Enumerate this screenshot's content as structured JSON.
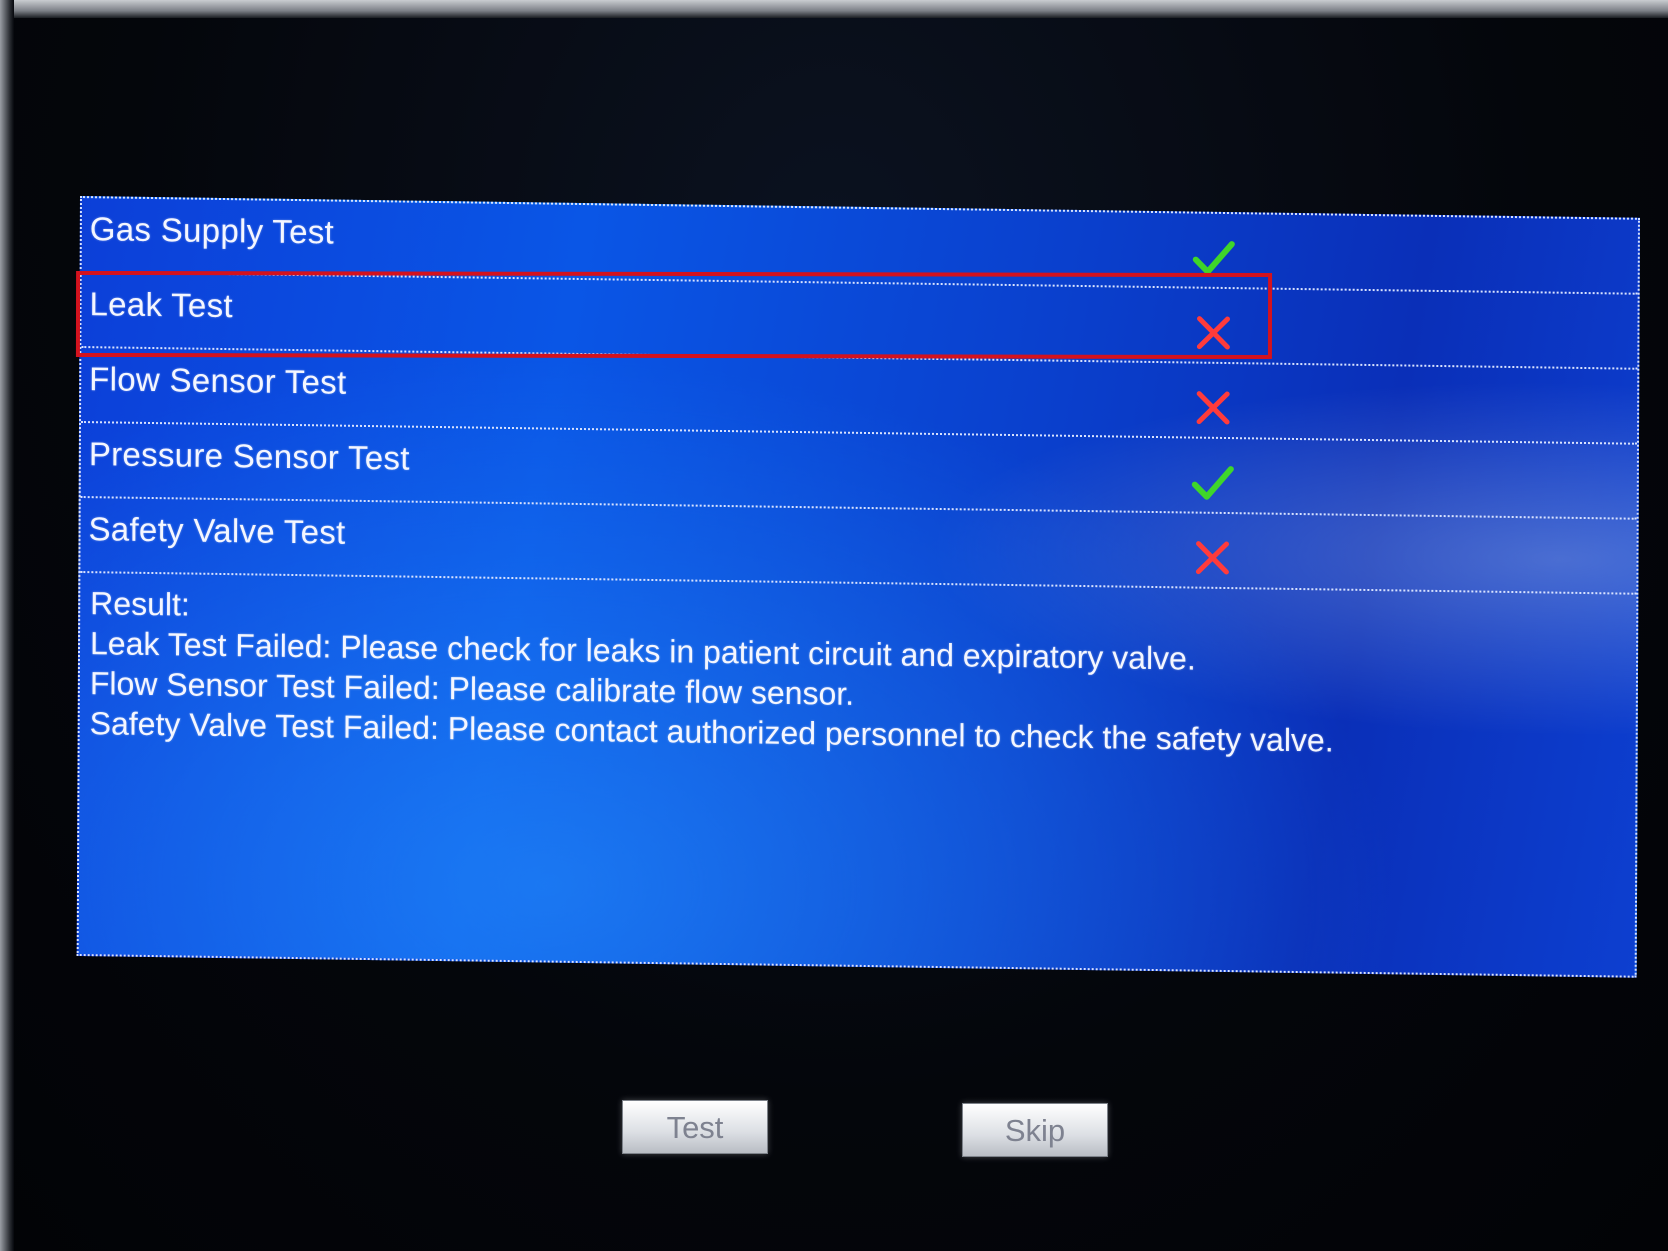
{
  "tests": [
    {
      "label": "Gas Supply Test",
      "status": "pass",
      "icon": "check-icon"
    },
    {
      "label": "Leak Test",
      "status": "fail",
      "icon": "cross-icon"
    },
    {
      "label": "Flow Sensor Test",
      "status": "fail",
      "icon": "cross-icon"
    },
    {
      "label": "Pressure Sensor Test",
      "status": "pass",
      "icon": "check-icon"
    },
    {
      "label": "Safety Valve Test",
      "status": "fail",
      "icon": "cross-icon"
    }
  ],
  "result": {
    "heading": "Result:",
    "lines": [
      "Leak Test Failed: Please check for leaks in patient circuit and expiratory valve.",
      "Flow Sensor Test Failed: Please calibrate flow sensor.",
      "Safety Valve Test Failed: Please contact authorized personnel to check the safety valve."
    ]
  },
  "buttons": {
    "test_label": "Test",
    "skip_label": "Skip"
  },
  "colors": {
    "pass": "#3fd62a",
    "fail": "#ff3b3b",
    "highlight": "#d3121e",
    "panel": "#0a4ad8"
  }
}
